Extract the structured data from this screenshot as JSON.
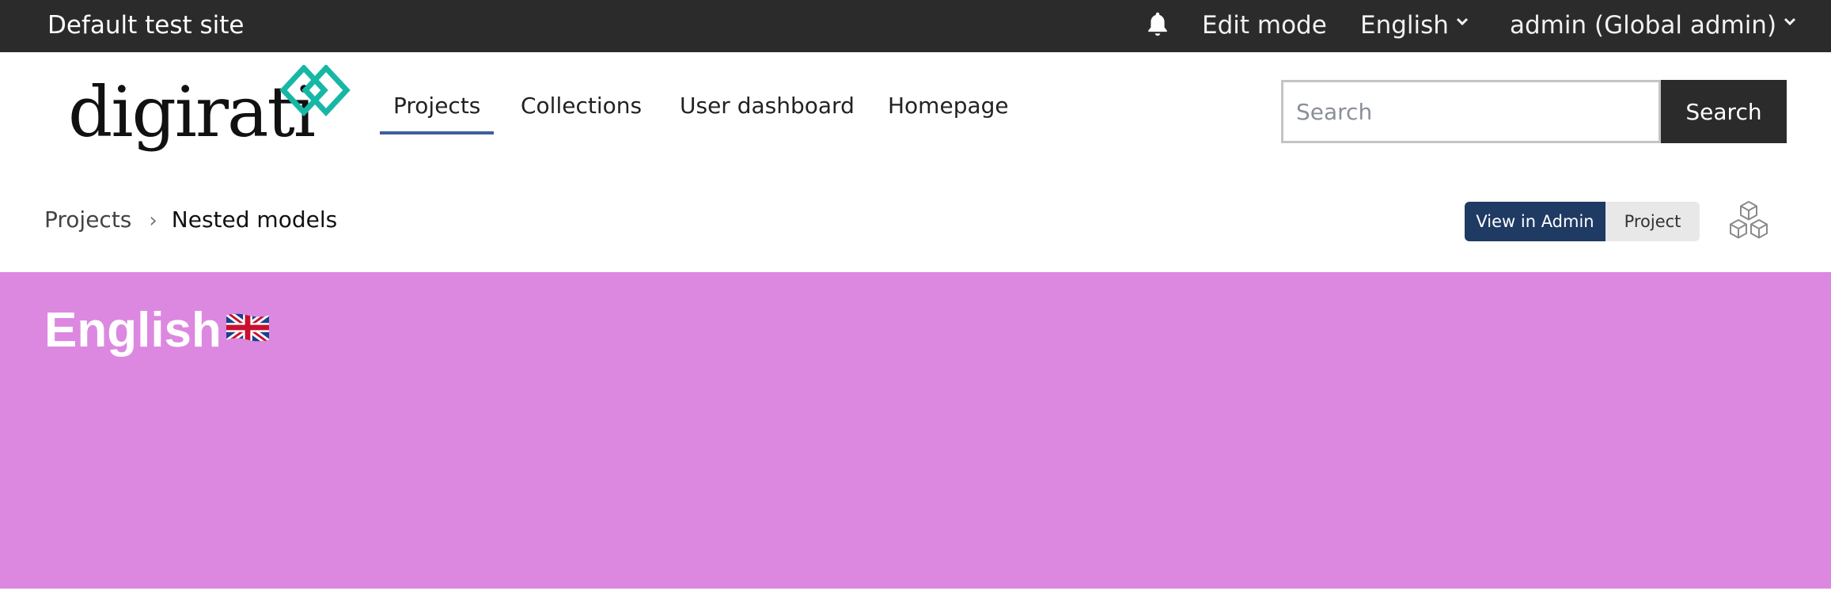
{
  "topbar": {
    "site_name": "Default test site",
    "bell_icon": "bell-icon",
    "edit_mode": "Edit mode",
    "language": "English",
    "user": "admin (Global admin)"
  },
  "nav": {
    "logo_text": "digirati",
    "links": [
      "Projects",
      "Collections",
      "User dashboard",
      "Homepage"
    ],
    "active_link": "Projects",
    "search_placeholder": "Search",
    "search_button": "Search"
  },
  "breadcrumb": {
    "items": [
      "Projects",
      "Nested models"
    ]
  },
  "actions": {
    "view_in_admin": "View in Admin",
    "project": "Project",
    "model_icon": "cubes-icon"
  },
  "banner": {
    "title": "English",
    "flag_icon": "uk-flag-icon",
    "color": "#dc88e0"
  },
  "colors": {
    "topbar": "#2b2b2b",
    "accent": "#3d5f9a",
    "admin_button": "#1f3a63",
    "logo_mark": "#17b7a6"
  }
}
